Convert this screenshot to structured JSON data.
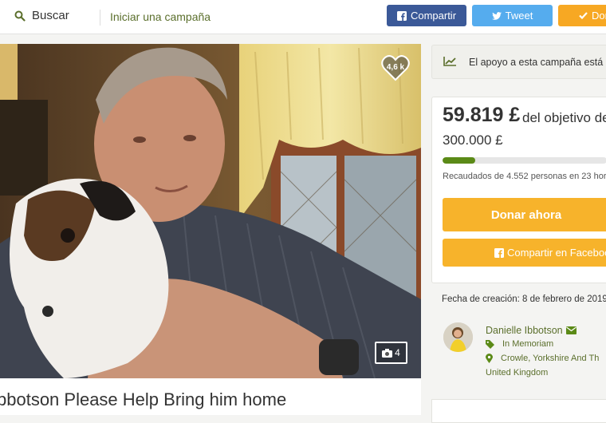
{
  "header": {
    "search_label": "Buscar",
    "start_campaign": "Iniciar una campaña",
    "share_button": "Compartir",
    "tweet_button": "Tweet",
    "donate_button": "Don"
  },
  "hero": {
    "likes": "4,6 k",
    "photo_count": "4",
    "title": "bbotson Please Help Bring him home"
  },
  "sidebar": {
    "status_text": "El apoyo a esta campaña está c",
    "raised": "59.819 £",
    "of_goal": "del objetivo de",
    "goal": "300.000 £",
    "progress_fraction": 0.2,
    "backers": "Recaudados de 4.552 personas en 23 hor",
    "donate_now": "Donar ahora",
    "share_facebook": "Compartir en Faceboo",
    "created": "Fecha de creación: 8 de febrero de 2019",
    "organizer": {
      "name": "Danielle Ibbotson",
      "category": "In Memoriam",
      "location_line1": "Crowle, Yorkshire And Th",
      "location_line2": "United Kingdom"
    }
  },
  "colors": {
    "facebook": "#3b5998",
    "twitter": "#55acee",
    "donate": "#f7b32b",
    "progress": "#5b8a17",
    "brand_green": "#5b6f2c"
  }
}
